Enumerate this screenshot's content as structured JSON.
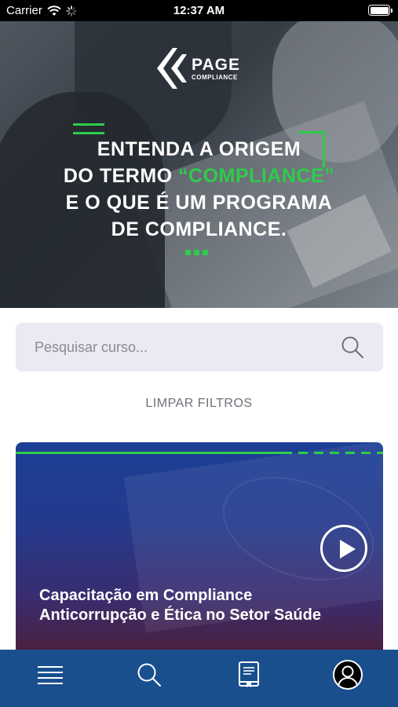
{
  "status_bar": {
    "carrier": "Carrier",
    "time": "12:37 AM"
  },
  "hero": {
    "logo_big": "PAGE",
    "logo_small": "COMPLIANCE",
    "line1": "ENTENDA A ORIGEM",
    "line2_prefix": "DO TERMO ",
    "line2_highlight": "“COMPLIANCE”",
    "line3": "E O QUE É UM PROGRAMA",
    "line4": "DE COMPLIANCE."
  },
  "search": {
    "placeholder": "Pesquisar curso...",
    "value": ""
  },
  "filters": {
    "clear_label": "LIMPAR FILTROS"
  },
  "courses": [
    {
      "title_line1": "Capacitação em Compliance",
      "title_line2": "Anticorrupção e Ética no Setor Saúde"
    }
  ],
  "tab_bar": {
    "items": [
      "menu-icon",
      "search-icon",
      "book-icon",
      "profile-icon"
    ]
  },
  "colors": {
    "accent_green": "#2ecc4a",
    "tab_bar_blue": "#1a4f8d",
    "search_bg": "#eaeaf2"
  }
}
